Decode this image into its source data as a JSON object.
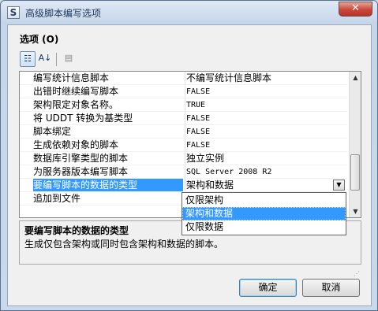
{
  "window": {
    "title": "高级脚本编写选项",
    "close_glyph": "✕",
    "app_icon_letter": "S"
  },
  "options_header": "选项 (O)",
  "toolbar": {
    "categorized_icon": "categorized-icon",
    "alphabetical_icon": "alphabetical-icon",
    "property_pages_icon": "property-pages-icon",
    "alpha_glyph": "A↓",
    "cat_glyph": "☷",
    "pages_glyph": "▤"
  },
  "grid": {
    "rows": [
      {
        "name": "编写统计信息脚本",
        "value": "不编写统计信息脚本",
        "mono": false
      },
      {
        "name": "出错时继续编写脚本",
        "value": "FALSE",
        "mono": true
      },
      {
        "name": "架构限定对象名称。",
        "value": "TRUE",
        "mono": true
      },
      {
        "name": "将 UDDT 转换为基类型",
        "value": "FALSE",
        "mono": true
      },
      {
        "name": "脚本绑定",
        "value": "FALSE",
        "mono": true
      },
      {
        "name": "生成依赖对象的脚本",
        "value": "FALSE",
        "mono": true
      },
      {
        "name": "数据库引擎类型的脚本",
        "value": "独立实例",
        "mono": false
      },
      {
        "name": "为服务器版本编写脚本",
        "value": "SQL Server 2008 R2",
        "mono": true
      },
      {
        "name": "要编写脚本的数据的类型",
        "value": "架构和数据",
        "mono": false,
        "selected": true
      },
      {
        "name": "追加到文件",
        "value": "",
        "mono": false
      }
    ],
    "combo_arrow": "▼",
    "scroll_up": "▲",
    "scroll_down": "▼"
  },
  "dropdown": {
    "options": [
      "仅限架构",
      "架构和数据",
      "仅限数据"
    ],
    "highlighted": "架构和数据"
  },
  "description": {
    "title": "要编写脚本的数据的类型",
    "text": "生成仅包含架构或同时包含架构和数据的脚本。"
  },
  "buttons": {
    "ok": "确定",
    "cancel": "取消"
  },
  "colors": {
    "selection": "#3399ff",
    "accent_border": "#3c7fb1"
  }
}
